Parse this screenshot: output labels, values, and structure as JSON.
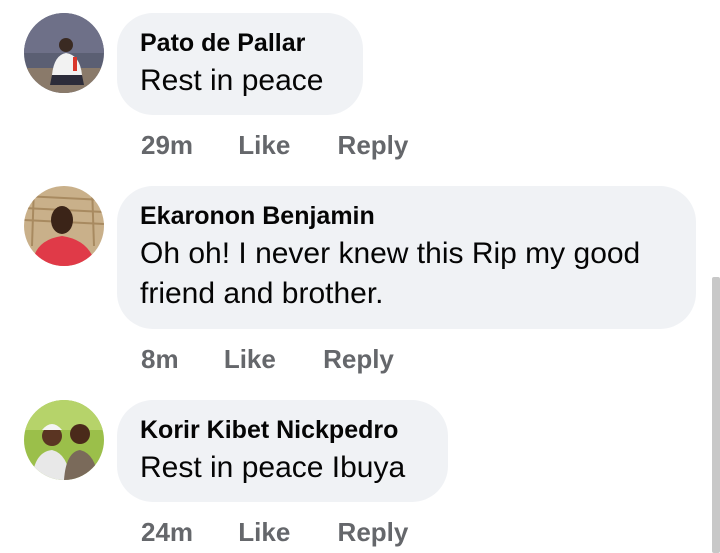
{
  "comments": [
    {
      "author": "Pato de Pallar",
      "text": "Rest in peace",
      "time": "29m",
      "like_label": "Like",
      "reply_label": "Reply",
      "avatar_icon": "profile-photo"
    },
    {
      "author": "Ekaronon Benjamin",
      "text": "Oh oh! I never knew this Rip my good friend and brother.",
      "time": "8m",
      "like_label": "Like",
      "reply_label": "Reply",
      "avatar_icon": "profile-photo"
    },
    {
      "author": "Korir Kibet Nickpedro",
      "text": "Rest in peace Ibuya",
      "time": "24m",
      "like_label": "Like",
      "reply_label": "Reply",
      "avatar_icon": "profile-photo"
    }
  ],
  "colors": {
    "bubble_bg": "#f0f2f5",
    "action_text": "#65676b",
    "name_text": "#050505"
  }
}
